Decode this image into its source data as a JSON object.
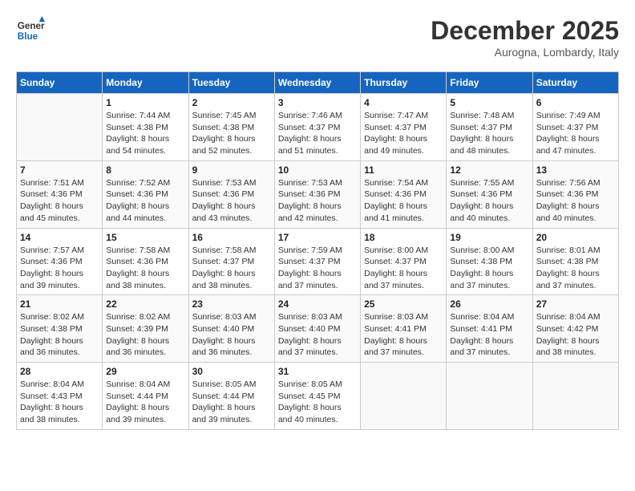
{
  "logo": {
    "line1": "General",
    "line2": "Blue"
  },
  "title": "December 2025",
  "subtitle": "Aurogna, Lombardy, Italy",
  "days_of_week": [
    "Sunday",
    "Monday",
    "Tuesday",
    "Wednesday",
    "Thursday",
    "Friday",
    "Saturday"
  ],
  "weeks": [
    [
      {
        "day": "",
        "sunrise": "",
        "sunset": "",
        "daylight": ""
      },
      {
        "day": "1",
        "sunrise": "Sunrise: 7:44 AM",
        "sunset": "Sunset: 4:38 PM",
        "daylight": "Daylight: 8 hours and 54 minutes."
      },
      {
        "day": "2",
        "sunrise": "Sunrise: 7:45 AM",
        "sunset": "Sunset: 4:38 PM",
        "daylight": "Daylight: 8 hours and 52 minutes."
      },
      {
        "day": "3",
        "sunrise": "Sunrise: 7:46 AM",
        "sunset": "Sunset: 4:37 PM",
        "daylight": "Daylight: 8 hours and 51 minutes."
      },
      {
        "day": "4",
        "sunrise": "Sunrise: 7:47 AM",
        "sunset": "Sunset: 4:37 PM",
        "daylight": "Daylight: 8 hours and 49 minutes."
      },
      {
        "day": "5",
        "sunrise": "Sunrise: 7:48 AM",
        "sunset": "Sunset: 4:37 PM",
        "daylight": "Daylight: 8 hours and 48 minutes."
      },
      {
        "day": "6",
        "sunrise": "Sunrise: 7:49 AM",
        "sunset": "Sunset: 4:37 PM",
        "daylight": "Daylight: 8 hours and 47 minutes."
      }
    ],
    [
      {
        "day": "7",
        "sunrise": "Sunrise: 7:51 AM",
        "sunset": "Sunset: 4:36 PM",
        "daylight": "Daylight: 8 hours and 45 minutes."
      },
      {
        "day": "8",
        "sunrise": "Sunrise: 7:52 AM",
        "sunset": "Sunset: 4:36 PM",
        "daylight": "Daylight: 8 hours and 44 minutes."
      },
      {
        "day": "9",
        "sunrise": "Sunrise: 7:53 AM",
        "sunset": "Sunset: 4:36 PM",
        "daylight": "Daylight: 8 hours and 43 minutes."
      },
      {
        "day": "10",
        "sunrise": "Sunrise: 7:53 AM",
        "sunset": "Sunset: 4:36 PM",
        "daylight": "Daylight: 8 hours and 42 minutes."
      },
      {
        "day": "11",
        "sunrise": "Sunrise: 7:54 AM",
        "sunset": "Sunset: 4:36 PM",
        "daylight": "Daylight: 8 hours and 41 minutes."
      },
      {
        "day": "12",
        "sunrise": "Sunrise: 7:55 AM",
        "sunset": "Sunset: 4:36 PM",
        "daylight": "Daylight: 8 hours and 40 minutes."
      },
      {
        "day": "13",
        "sunrise": "Sunrise: 7:56 AM",
        "sunset": "Sunset: 4:36 PM",
        "daylight": "Daylight: 8 hours and 40 minutes."
      }
    ],
    [
      {
        "day": "14",
        "sunrise": "Sunrise: 7:57 AM",
        "sunset": "Sunset: 4:36 PM",
        "daylight": "Daylight: 8 hours and 39 minutes."
      },
      {
        "day": "15",
        "sunrise": "Sunrise: 7:58 AM",
        "sunset": "Sunset: 4:36 PM",
        "daylight": "Daylight: 8 hours and 38 minutes."
      },
      {
        "day": "16",
        "sunrise": "Sunrise: 7:58 AM",
        "sunset": "Sunset: 4:37 PM",
        "daylight": "Daylight: 8 hours and 38 minutes."
      },
      {
        "day": "17",
        "sunrise": "Sunrise: 7:59 AM",
        "sunset": "Sunset: 4:37 PM",
        "daylight": "Daylight: 8 hours and 37 minutes."
      },
      {
        "day": "18",
        "sunrise": "Sunrise: 8:00 AM",
        "sunset": "Sunset: 4:37 PM",
        "daylight": "Daylight: 8 hours and 37 minutes."
      },
      {
        "day": "19",
        "sunrise": "Sunrise: 8:00 AM",
        "sunset": "Sunset: 4:38 PM",
        "daylight": "Daylight: 8 hours and 37 minutes."
      },
      {
        "day": "20",
        "sunrise": "Sunrise: 8:01 AM",
        "sunset": "Sunset: 4:38 PM",
        "daylight": "Daylight: 8 hours and 37 minutes."
      }
    ],
    [
      {
        "day": "21",
        "sunrise": "Sunrise: 8:02 AM",
        "sunset": "Sunset: 4:38 PM",
        "daylight": "Daylight: 8 hours and 36 minutes."
      },
      {
        "day": "22",
        "sunrise": "Sunrise: 8:02 AM",
        "sunset": "Sunset: 4:39 PM",
        "daylight": "Daylight: 8 hours and 36 minutes."
      },
      {
        "day": "23",
        "sunrise": "Sunrise: 8:03 AM",
        "sunset": "Sunset: 4:40 PM",
        "daylight": "Daylight: 8 hours and 36 minutes."
      },
      {
        "day": "24",
        "sunrise": "Sunrise: 8:03 AM",
        "sunset": "Sunset: 4:40 PM",
        "daylight": "Daylight: 8 hours and 37 minutes."
      },
      {
        "day": "25",
        "sunrise": "Sunrise: 8:03 AM",
        "sunset": "Sunset: 4:41 PM",
        "daylight": "Daylight: 8 hours and 37 minutes."
      },
      {
        "day": "26",
        "sunrise": "Sunrise: 8:04 AM",
        "sunset": "Sunset: 4:41 PM",
        "daylight": "Daylight: 8 hours and 37 minutes."
      },
      {
        "day": "27",
        "sunrise": "Sunrise: 8:04 AM",
        "sunset": "Sunset: 4:42 PM",
        "daylight": "Daylight: 8 hours and 38 minutes."
      }
    ],
    [
      {
        "day": "28",
        "sunrise": "Sunrise: 8:04 AM",
        "sunset": "Sunset: 4:43 PM",
        "daylight": "Daylight: 8 hours and 38 minutes."
      },
      {
        "day": "29",
        "sunrise": "Sunrise: 8:04 AM",
        "sunset": "Sunset: 4:44 PM",
        "daylight": "Daylight: 8 hours and 39 minutes."
      },
      {
        "day": "30",
        "sunrise": "Sunrise: 8:05 AM",
        "sunset": "Sunset: 4:44 PM",
        "daylight": "Daylight: 8 hours and 39 minutes."
      },
      {
        "day": "31",
        "sunrise": "Sunrise: 8:05 AM",
        "sunset": "Sunset: 4:45 PM",
        "daylight": "Daylight: 8 hours and 40 minutes."
      },
      {
        "day": "",
        "sunrise": "",
        "sunset": "",
        "daylight": ""
      },
      {
        "day": "",
        "sunrise": "",
        "sunset": "",
        "daylight": ""
      },
      {
        "day": "",
        "sunrise": "",
        "sunset": "",
        "daylight": ""
      }
    ]
  ]
}
